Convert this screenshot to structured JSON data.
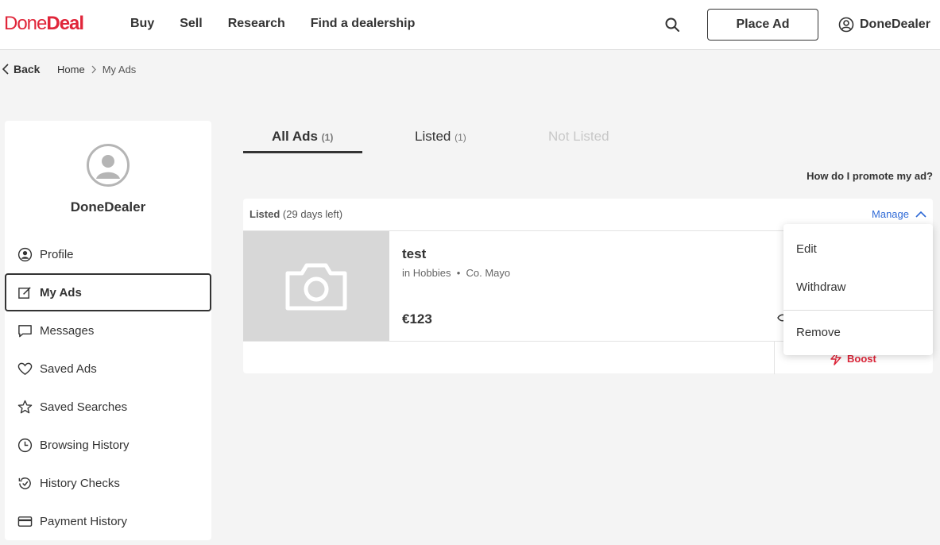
{
  "header": {
    "logo_done": "Done",
    "logo_deal": "Deal",
    "nav": [
      "Buy",
      "Sell",
      "Research",
      "Find a dealership"
    ],
    "place_ad": "Place Ad",
    "username": "DoneDealer"
  },
  "breadcrumb": {
    "back": "Back",
    "home": "Home",
    "current": "My Ads"
  },
  "sidebar": {
    "username": "DoneDealer",
    "items": [
      {
        "label": "Profile",
        "icon": "user-circle-icon"
      },
      {
        "label": "My Ads",
        "icon": "edit-icon"
      },
      {
        "label": "Messages",
        "icon": "message-icon"
      },
      {
        "label": "Saved Ads",
        "icon": "heart-icon"
      },
      {
        "label": "Saved Searches",
        "icon": "star-icon"
      },
      {
        "label": "Browsing History",
        "icon": "clock-icon"
      },
      {
        "label": "History Checks",
        "icon": "history-check-icon"
      },
      {
        "label": "Payment History",
        "icon": "credit-card-icon"
      }
    ]
  },
  "tabs": {
    "all": {
      "label": "All Ads",
      "count": "(1)"
    },
    "listed": {
      "label": "Listed",
      "count": "(1)"
    },
    "not_listed": {
      "label": "Not Listed"
    }
  },
  "promote_link": "How do I promote my ad?",
  "ad": {
    "status": "Listed",
    "days_left": "(29 days left)",
    "manage": "Manage",
    "title": "test",
    "category_prefix": "in",
    "category": "Hobbies",
    "location": "Co. Mayo",
    "price": "€123",
    "boost": "Boost"
  },
  "dropdown": {
    "edit": "Edit",
    "withdraw": "Withdraw",
    "remove": "Remove"
  },
  "colors": {
    "brand_red": "#e0263a",
    "link_blue": "#2f6ad6"
  }
}
